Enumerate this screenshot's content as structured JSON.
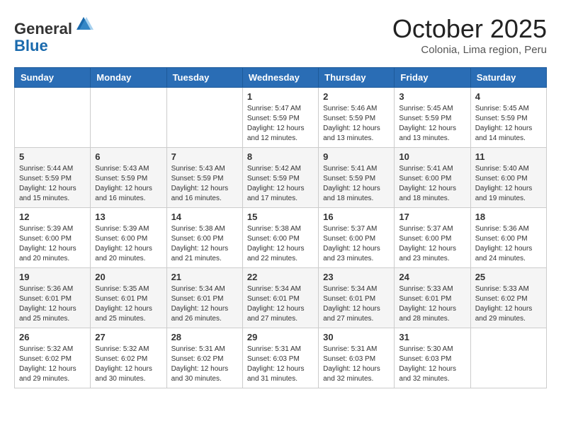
{
  "header": {
    "logo_general": "General",
    "logo_blue": "Blue",
    "month_title": "October 2025",
    "location": "Colonia, Lima region, Peru"
  },
  "weekdays": [
    "Sunday",
    "Monday",
    "Tuesday",
    "Wednesday",
    "Thursday",
    "Friday",
    "Saturday"
  ],
  "weeks": [
    [
      {
        "day": "",
        "info": ""
      },
      {
        "day": "",
        "info": ""
      },
      {
        "day": "",
        "info": ""
      },
      {
        "day": "1",
        "info": "Sunrise: 5:47 AM\nSunset: 5:59 PM\nDaylight: 12 hours\nand 12 minutes."
      },
      {
        "day": "2",
        "info": "Sunrise: 5:46 AM\nSunset: 5:59 PM\nDaylight: 12 hours\nand 13 minutes."
      },
      {
        "day": "3",
        "info": "Sunrise: 5:45 AM\nSunset: 5:59 PM\nDaylight: 12 hours\nand 13 minutes."
      },
      {
        "day": "4",
        "info": "Sunrise: 5:45 AM\nSunset: 5:59 PM\nDaylight: 12 hours\nand 14 minutes."
      }
    ],
    [
      {
        "day": "5",
        "info": "Sunrise: 5:44 AM\nSunset: 5:59 PM\nDaylight: 12 hours\nand 15 minutes."
      },
      {
        "day": "6",
        "info": "Sunrise: 5:43 AM\nSunset: 5:59 PM\nDaylight: 12 hours\nand 16 minutes."
      },
      {
        "day": "7",
        "info": "Sunrise: 5:43 AM\nSunset: 5:59 PM\nDaylight: 12 hours\nand 16 minutes."
      },
      {
        "day": "8",
        "info": "Sunrise: 5:42 AM\nSunset: 5:59 PM\nDaylight: 12 hours\nand 17 minutes."
      },
      {
        "day": "9",
        "info": "Sunrise: 5:41 AM\nSunset: 5:59 PM\nDaylight: 12 hours\nand 18 minutes."
      },
      {
        "day": "10",
        "info": "Sunrise: 5:41 AM\nSunset: 6:00 PM\nDaylight: 12 hours\nand 18 minutes."
      },
      {
        "day": "11",
        "info": "Sunrise: 5:40 AM\nSunset: 6:00 PM\nDaylight: 12 hours\nand 19 minutes."
      }
    ],
    [
      {
        "day": "12",
        "info": "Sunrise: 5:39 AM\nSunset: 6:00 PM\nDaylight: 12 hours\nand 20 minutes."
      },
      {
        "day": "13",
        "info": "Sunrise: 5:39 AM\nSunset: 6:00 PM\nDaylight: 12 hours\nand 20 minutes."
      },
      {
        "day": "14",
        "info": "Sunrise: 5:38 AM\nSunset: 6:00 PM\nDaylight: 12 hours\nand 21 minutes."
      },
      {
        "day": "15",
        "info": "Sunrise: 5:38 AM\nSunset: 6:00 PM\nDaylight: 12 hours\nand 22 minutes."
      },
      {
        "day": "16",
        "info": "Sunrise: 5:37 AM\nSunset: 6:00 PM\nDaylight: 12 hours\nand 23 minutes."
      },
      {
        "day": "17",
        "info": "Sunrise: 5:37 AM\nSunset: 6:00 PM\nDaylight: 12 hours\nand 23 minutes."
      },
      {
        "day": "18",
        "info": "Sunrise: 5:36 AM\nSunset: 6:00 PM\nDaylight: 12 hours\nand 24 minutes."
      }
    ],
    [
      {
        "day": "19",
        "info": "Sunrise: 5:36 AM\nSunset: 6:01 PM\nDaylight: 12 hours\nand 25 minutes."
      },
      {
        "day": "20",
        "info": "Sunrise: 5:35 AM\nSunset: 6:01 PM\nDaylight: 12 hours\nand 25 minutes."
      },
      {
        "day": "21",
        "info": "Sunrise: 5:34 AM\nSunset: 6:01 PM\nDaylight: 12 hours\nand 26 minutes."
      },
      {
        "day": "22",
        "info": "Sunrise: 5:34 AM\nSunset: 6:01 PM\nDaylight: 12 hours\nand 27 minutes."
      },
      {
        "day": "23",
        "info": "Sunrise: 5:34 AM\nSunset: 6:01 PM\nDaylight: 12 hours\nand 27 minutes."
      },
      {
        "day": "24",
        "info": "Sunrise: 5:33 AM\nSunset: 6:01 PM\nDaylight: 12 hours\nand 28 minutes."
      },
      {
        "day": "25",
        "info": "Sunrise: 5:33 AM\nSunset: 6:02 PM\nDaylight: 12 hours\nand 29 minutes."
      }
    ],
    [
      {
        "day": "26",
        "info": "Sunrise: 5:32 AM\nSunset: 6:02 PM\nDaylight: 12 hours\nand 29 minutes."
      },
      {
        "day": "27",
        "info": "Sunrise: 5:32 AM\nSunset: 6:02 PM\nDaylight: 12 hours\nand 30 minutes."
      },
      {
        "day": "28",
        "info": "Sunrise: 5:31 AM\nSunset: 6:02 PM\nDaylight: 12 hours\nand 30 minutes."
      },
      {
        "day": "29",
        "info": "Sunrise: 5:31 AM\nSunset: 6:03 PM\nDaylight: 12 hours\nand 31 minutes."
      },
      {
        "day": "30",
        "info": "Sunrise: 5:31 AM\nSunset: 6:03 PM\nDaylight: 12 hours\nand 32 minutes."
      },
      {
        "day": "31",
        "info": "Sunrise: 5:30 AM\nSunset: 6:03 PM\nDaylight: 12 hours\nand 32 minutes."
      },
      {
        "day": "",
        "info": ""
      }
    ]
  ]
}
